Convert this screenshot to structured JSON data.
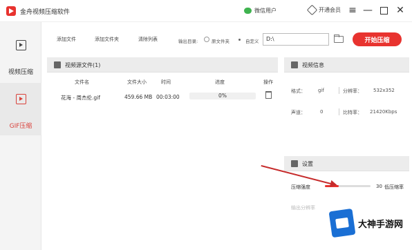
{
  "app": {
    "title": "金舟视频压缩软件"
  },
  "header": {
    "wechat_label": "微信用户",
    "vip_label": "开通会员"
  },
  "sidebar": {
    "items": [
      {
        "label": "视频压缩",
        "icon": "video-icon",
        "active": false
      },
      {
        "label": "GIF压缩",
        "icon": "gif-icon",
        "active": true
      }
    ]
  },
  "toolbar": {
    "add_file": "添加文件",
    "add_folder": "添加文件夹",
    "clear_list": "清除列表",
    "output_dir_label": "输出目录:",
    "original_folder": "原文件夹",
    "custom": "自定义",
    "output_path": "D:\\",
    "start_button": "开始压缩"
  },
  "video_list": {
    "title": "视频源文件(1)",
    "columns": [
      "文件名",
      "文件大小",
      "时间",
      "进度",
      "操作"
    ],
    "rows": [
      {
        "name": "花海 - 周杰伦.gif",
        "size": "459.66 MB",
        "time": "00:03:00",
        "progress": "0%"
      }
    ]
  },
  "video_info": {
    "title": "视频信息",
    "format_label": "格式：",
    "format_value": "gif",
    "resolution_label": "分辨率：",
    "resolution_value": "532x352",
    "audio_label": "声道：",
    "audio_value": "0",
    "bitrate_label": "比特率：",
    "bitrate_value": "21420Kbps"
  },
  "settings": {
    "title": "设置",
    "compress_label": "压缩强度",
    "compress_value": "30",
    "compress_hint": "低压缩率",
    "compress_fraction": 0.3,
    "resolution_label": "输出分辨率"
  },
  "watermark": {
    "text": "大神手游网"
  },
  "colors": {
    "accent": "#e8332f"
  }
}
